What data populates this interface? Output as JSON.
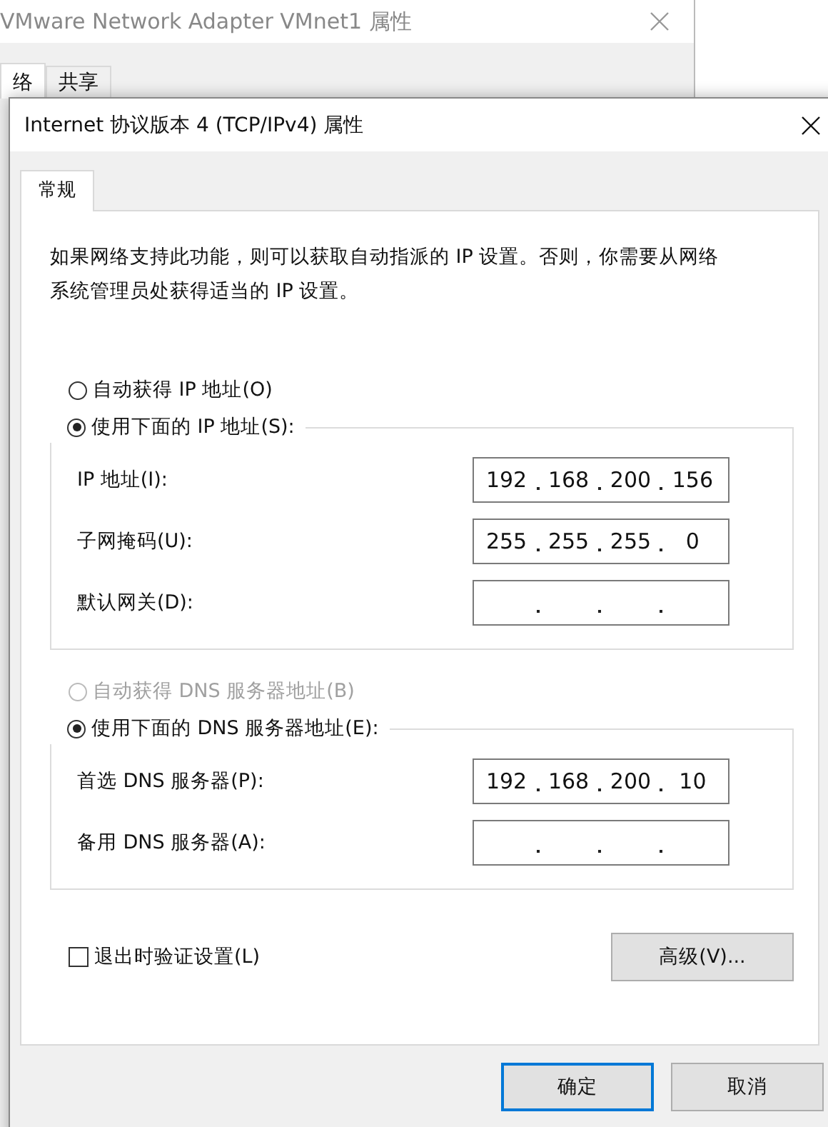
{
  "background_window": {
    "title": "VMware Network Adapter VMnet1 属性",
    "tabs": [
      {
        "label": "络",
        "selected": true
      },
      {
        "label": "共享",
        "selected": false
      }
    ]
  },
  "dialog": {
    "title": "Internet 协议版本 4 (TCP/IPv4) 属性",
    "tabs": [
      {
        "label": "常规",
        "selected": true
      }
    ],
    "description": "如果网络支持此功能，则可以获取自动指派的 IP 设置。否则，你需要从网络系统管理员处获得适当的 IP 设置。",
    "ip_mode": [
      {
        "label": "自动获得 IP 地址(O)",
        "selected": false,
        "disabled": false
      },
      {
        "label": "使用下面的 IP 地址(S):",
        "selected": true,
        "disabled": false
      }
    ],
    "ip_fields": [
      {
        "label": "IP 地址(I):",
        "octets": [
          "192",
          "168",
          "200",
          "156"
        ]
      },
      {
        "label": "子网掩码(U):",
        "octets": [
          "255",
          "255",
          "255",
          "0"
        ]
      },
      {
        "label": "默认网关(D):"
      }
    ],
    "dns_mode": [
      {
        "label": "自动获得 DNS 服务器地址(B)",
        "selected": false,
        "disabled": true
      },
      {
        "label": "使用下面的 DNS 服务器地址(E):",
        "selected": true,
        "disabled": false
      }
    ],
    "dns_fields": [
      {
        "label": "首选 DNS 服务器(P):",
        "octets": [
          "192",
          "168",
          "200",
          "10"
        ]
      },
      {
        "label": "备用 DNS 服务器(A):"
      }
    ],
    "validate_checkbox": {
      "label": "退出时验证设置(L)",
      "checked": false
    },
    "advanced_button": "高级(V)...",
    "buttons": [
      {
        "label": "确定",
        "default": true
      },
      {
        "label": "取消",
        "default": false
      }
    ]
  }
}
